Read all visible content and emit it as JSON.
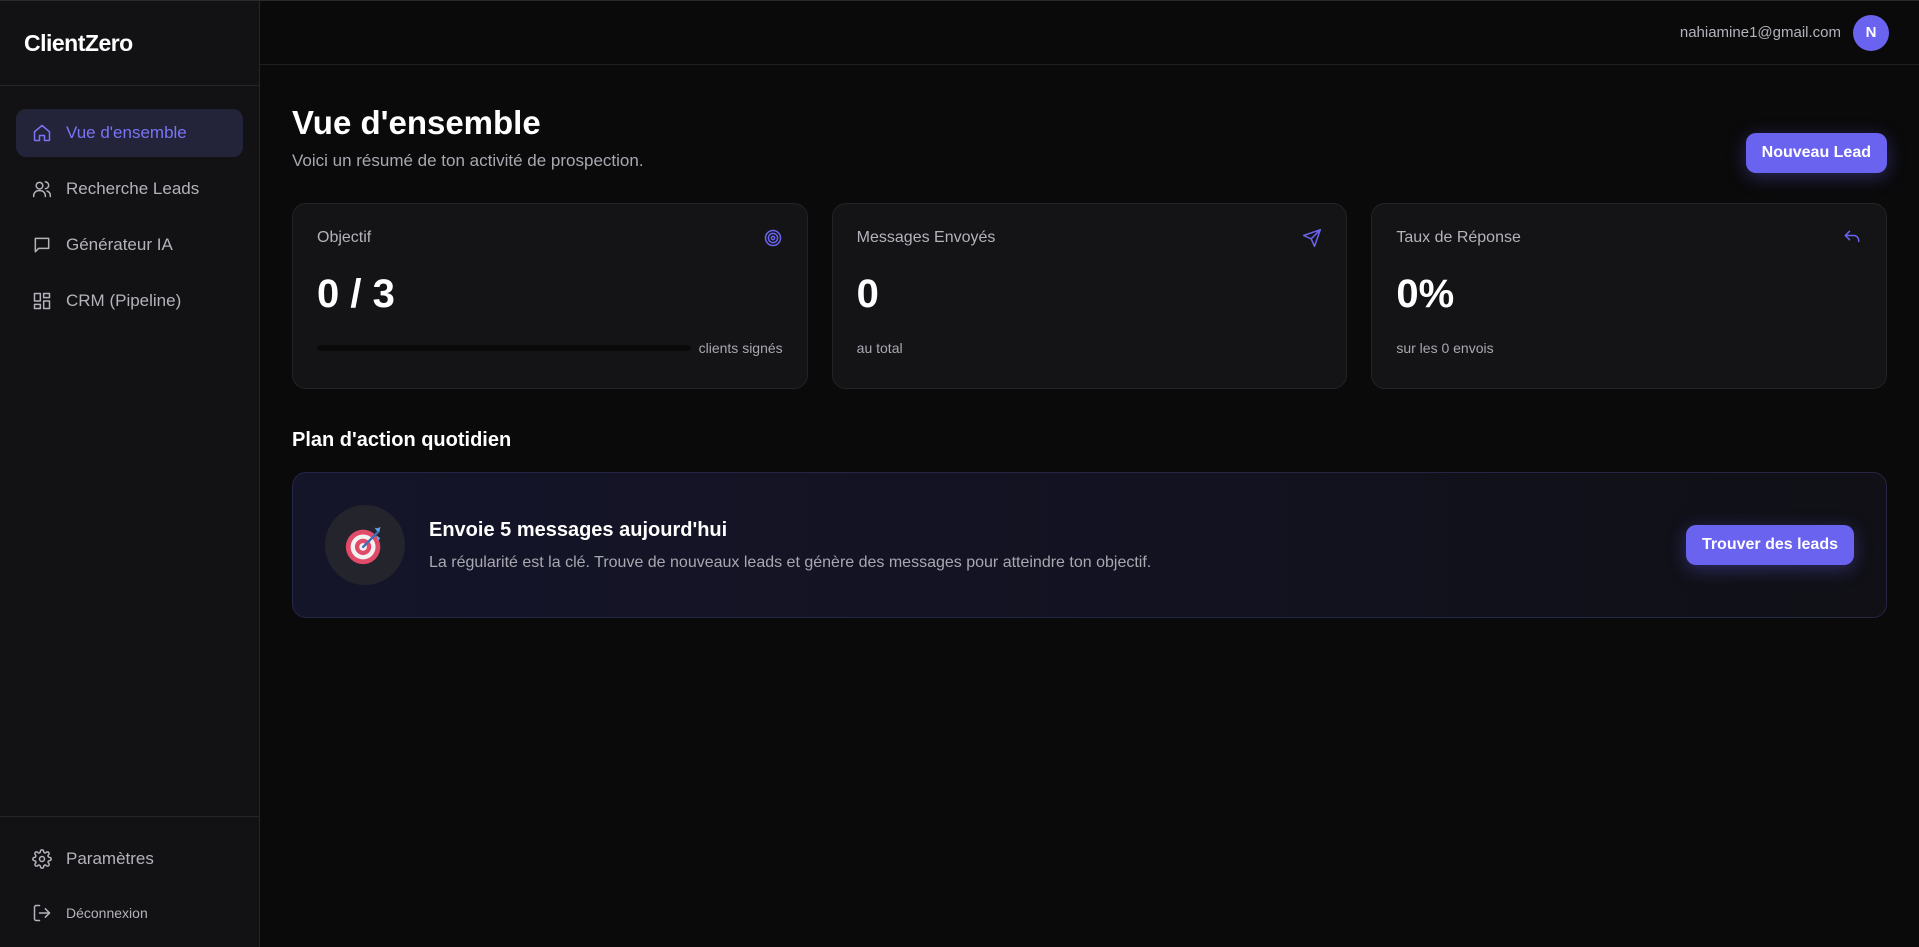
{
  "app": {
    "brand": "ClientZero"
  },
  "colors": {
    "accent": "#6a63f0",
    "background": "#0a0a0b",
    "sidebar": "#121214",
    "card": "#141416"
  },
  "sidebar": {
    "items": [
      {
        "label": "Vue d'ensemble",
        "icon": "home-icon",
        "active": true
      },
      {
        "label": "Recherche Leads",
        "icon": "users-icon",
        "active": false
      },
      {
        "label": "Générateur IA",
        "icon": "chat-icon",
        "active": false
      },
      {
        "label": "CRM (Pipeline)",
        "icon": "grid-icon",
        "active": false
      }
    ],
    "settings": {
      "label": "Paramètres",
      "icon": "gear-icon"
    },
    "logout": {
      "label": "Déconnexion",
      "icon": "logout-icon"
    }
  },
  "topbar": {
    "email": "nahiamine1@gmail.com",
    "avatar_initial": "N"
  },
  "header": {
    "title": "Vue d'ensemble",
    "subtitle": "Voici un résumé de ton activité de prospection.",
    "new_lead_label": "Nouveau Lead"
  },
  "stats": [
    {
      "label": "Objectif",
      "value": "0 / 3",
      "foot": "clients signés",
      "icon": "target-icon",
      "progress": 0
    },
    {
      "label": "Messages Envoyés",
      "value": "0",
      "foot": "au total",
      "icon": "send-icon"
    },
    {
      "label": "Taux de Réponse",
      "value": "0%",
      "foot": "sur les 0 envois",
      "icon": "reply-icon"
    }
  ],
  "plan": {
    "section_title": "Plan d'action quotidien",
    "title": "Envoie 5 messages aujourd'hui",
    "description": "La régularité est la clé. Trouve de nouveaux leads et génère des messages pour atteindre ton objectif.",
    "button_label": "Trouver des leads",
    "icon": "bullseye-dart-icon"
  }
}
